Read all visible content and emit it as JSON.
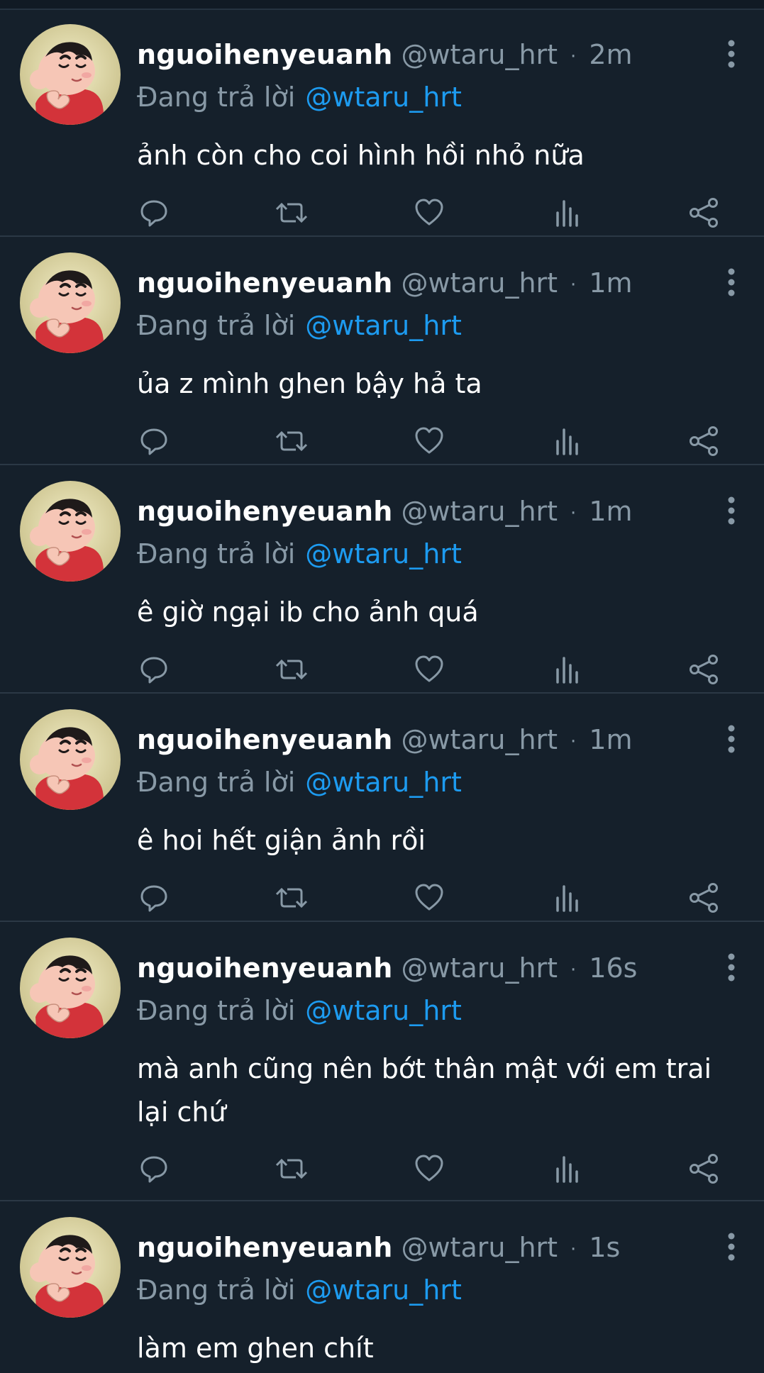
{
  "icons": {
    "more": "more-vertical-icon",
    "reply": "reply-icon",
    "retweet": "retweet-icon",
    "like": "like-icon",
    "views": "views-icon",
    "share": "share-icon"
  },
  "colors": {
    "background": "#15202b",
    "name": "#ffffff",
    "secondary_text": "#8899a6",
    "mention": "#1d9bf0",
    "divider": "#2b3845"
  },
  "tweets": [
    {
      "author_name": "nguoihenyeuanh",
      "handle": "@wtaru_hrt",
      "separator": "·",
      "time": "2m",
      "reply_prefix": "Đang trả lời",
      "reply_to": "@wtaru_hrt",
      "text": "ảnh còn cho coi hình hồi nhỏ nữa"
    },
    {
      "author_name": "nguoihenyeuanh",
      "handle": "@wtaru_hrt",
      "separator": "·",
      "time": "1m",
      "reply_prefix": "Đang trả lời",
      "reply_to": "@wtaru_hrt",
      "text": "ủa z mình ghen bậy hả ta"
    },
    {
      "author_name": "nguoihenyeuanh",
      "handle": "@wtaru_hrt",
      "separator": "·",
      "time": "1m",
      "reply_prefix": "Đang trả lời",
      "reply_to": "@wtaru_hrt",
      "text": "ê giờ ngại ib cho ảnh quá"
    },
    {
      "author_name": "nguoihenyeuanh",
      "handle": "@wtaru_hrt",
      "separator": "·",
      "time": "1m",
      "reply_prefix": "Đang trả lời",
      "reply_to": "@wtaru_hrt",
      "text": "ê hoi hết giận ảnh rồi"
    },
    {
      "author_name": "nguoihenyeuanh",
      "handle": "@wtaru_hrt",
      "separator": "·",
      "time": "16s",
      "reply_prefix": "Đang trả lời",
      "reply_to": "@wtaru_hrt",
      "text": "mà anh cũng nên bớt thân mật với em trai lại chứ"
    },
    {
      "author_name": "nguoihenyeuanh",
      "handle": "@wtaru_hrt",
      "separator": "·",
      "time": "1s",
      "reply_prefix": "Đang trả lời",
      "reply_to": "@wtaru_hrt",
      "text": "làm em ghen chít"
    }
  ]
}
